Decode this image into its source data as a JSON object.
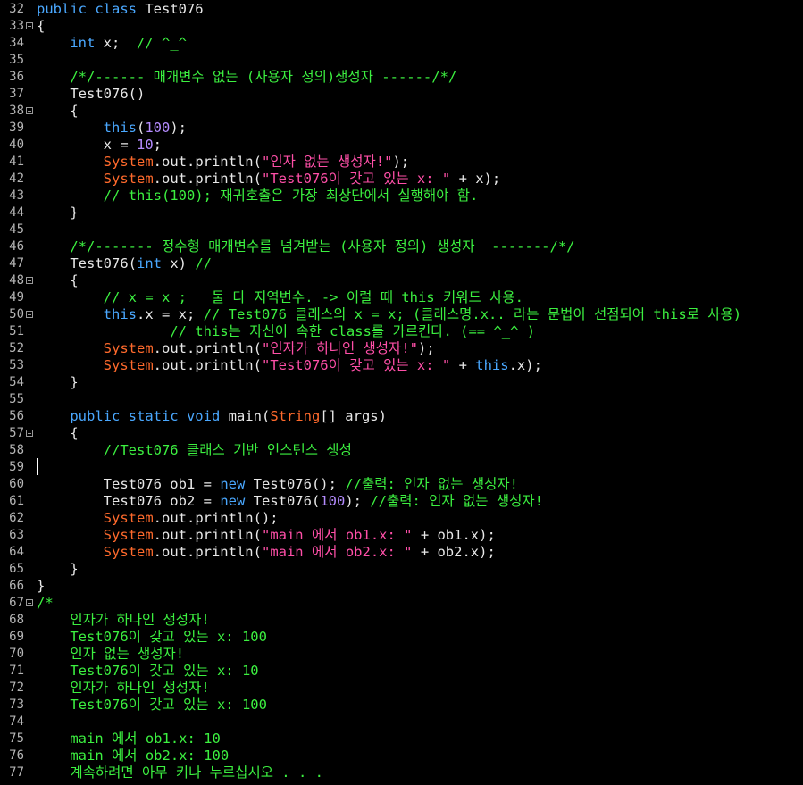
{
  "editor": {
    "colors": {
      "background": "#000000",
      "text": "#e8e8e8",
      "keyword": "#4aa8ff",
      "string": "#ff4fa8",
      "class": "#ff6a2c",
      "comment": "#3cf040",
      "number": "#b58cff",
      "line_number": "#b4b4b4"
    },
    "current_line": 59,
    "lines": [
      {
        "n": 32,
        "fold": false,
        "tokens": [
          {
            "t": "kw",
            "v": "public class"
          },
          {
            "t": "txt",
            "v": " Test076"
          }
        ]
      },
      {
        "n": 33,
        "fold": true,
        "tokens": [
          {
            "t": "txt",
            "v": "{"
          }
        ]
      },
      {
        "n": 34,
        "fold": false,
        "tokens": [
          {
            "t": "kw",
            "v": "    int"
          },
          {
            "t": "txt",
            "v": " x;  "
          },
          {
            "t": "cmt",
            "v": "// ^_^"
          }
        ]
      },
      {
        "n": 35,
        "fold": false,
        "tokens": []
      },
      {
        "n": 36,
        "fold": false,
        "tokens": [
          {
            "t": "cmt",
            "v": "    /*/------ 매개변수 없는 (사용자 정의)생성자 ------/*/"
          }
        ]
      },
      {
        "n": 37,
        "fold": false,
        "tokens": [
          {
            "t": "txt",
            "v": "    Test076()"
          }
        ]
      },
      {
        "n": 38,
        "fold": true,
        "tokens": [
          {
            "t": "txt",
            "v": "    {"
          }
        ]
      },
      {
        "n": 39,
        "fold": false,
        "tokens": [
          {
            "t": "kw",
            "v": "        this"
          },
          {
            "t": "txt",
            "v": "("
          },
          {
            "t": "num",
            "v": "100"
          },
          {
            "t": "txt",
            "v": ");"
          }
        ]
      },
      {
        "n": 40,
        "fold": false,
        "tokens": [
          {
            "t": "txt",
            "v": "        x = "
          },
          {
            "t": "num",
            "v": "10"
          },
          {
            "t": "txt",
            "v": ";"
          }
        ]
      },
      {
        "n": 41,
        "fold": false,
        "tokens": [
          {
            "t": "cls",
            "v": "        System"
          },
          {
            "t": "txt",
            "v": ".out.println("
          },
          {
            "t": "str",
            "v": "\"인자 없는 생성자!\""
          },
          {
            "t": "txt",
            "v": ");"
          }
        ]
      },
      {
        "n": 42,
        "fold": false,
        "tokens": [
          {
            "t": "cls",
            "v": "        System"
          },
          {
            "t": "txt",
            "v": ".out.println("
          },
          {
            "t": "str",
            "v": "\"Test076이 갖고 있는 x: \""
          },
          {
            "t": "txt",
            "v": " + x);"
          }
        ]
      },
      {
        "n": 43,
        "fold": false,
        "tokens": [
          {
            "t": "cmt",
            "v": "        // this(100); 재귀호출은 가장 최상단에서 실행해야 함."
          }
        ]
      },
      {
        "n": 44,
        "fold": false,
        "tokens": [
          {
            "t": "txt",
            "v": "    }"
          }
        ]
      },
      {
        "n": 45,
        "fold": false,
        "tokens": []
      },
      {
        "n": 46,
        "fold": false,
        "tokens": [
          {
            "t": "cmt",
            "v": "    /*/------- 정수형 매개변수를 넘겨받는 (사용자 정의) 생성자  -------/*/"
          }
        ]
      },
      {
        "n": 47,
        "fold": false,
        "tokens": [
          {
            "t": "txt",
            "v": "    Test076("
          },
          {
            "t": "kw",
            "v": "int"
          },
          {
            "t": "txt",
            "v": " x) "
          },
          {
            "t": "cmt",
            "v": "//"
          }
        ]
      },
      {
        "n": 48,
        "fold": true,
        "tokens": [
          {
            "t": "txt",
            "v": "    {"
          }
        ]
      },
      {
        "n": 49,
        "fold": false,
        "tokens": [
          {
            "t": "cmt",
            "v": "        // x = x ;   둘 다 지역변수. -> 이럴 때 this 키워드 사용."
          }
        ]
      },
      {
        "n": 50,
        "fold": true,
        "tokens": [
          {
            "t": "kw",
            "v": "        this"
          },
          {
            "t": "txt",
            "v": ".x = x; "
          },
          {
            "t": "cmt",
            "v": "// Test076 클래스의 x = x; (클래스명.x.. 라는 문법이 선점되어 this로 사용)"
          }
        ]
      },
      {
        "n": 51,
        "fold": false,
        "tokens": [
          {
            "t": "cmt",
            "v": "                // this는 자신이 속한 class를 가르킨다. (== ^_^ )"
          }
        ]
      },
      {
        "n": 52,
        "fold": false,
        "tokens": [
          {
            "t": "cls",
            "v": "        System"
          },
          {
            "t": "txt",
            "v": ".out.println("
          },
          {
            "t": "str",
            "v": "\"인자가 하나인 생성자!\""
          },
          {
            "t": "txt",
            "v": ");"
          }
        ]
      },
      {
        "n": 53,
        "fold": false,
        "tokens": [
          {
            "t": "cls",
            "v": "        System"
          },
          {
            "t": "txt",
            "v": ".out.println("
          },
          {
            "t": "str",
            "v": "\"Test076이 갖고 있는 x: \""
          },
          {
            "t": "txt",
            "v": " + "
          },
          {
            "t": "kw",
            "v": "this"
          },
          {
            "t": "txt",
            "v": ".x);"
          }
        ]
      },
      {
        "n": 54,
        "fold": false,
        "tokens": [
          {
            "t": "txt",
            "v": "    }"
          }
        ]
      },
      {
        "n": 55,
        "fold": false,
        "tokens": []
      },
      {
        "n": 56,
        "fold": false,
        "tokens": [
          {
            "t": "kw",
            "v": "    public static void"
          },
          {
            "t": "txt",
            "v": " main("
          },
          {
            "t": "cls",
            "v": "String"
          },
          {
            "t": "txt",
            "v": "[] args)"
          }
        ]
      },
      {
        "n": 57,
        "fold": true,
        "tokens": [
          {
            "t": "txt",
            "v": "    {"
          }
        ]
      },
      {
        "n": 58,
        "fold": false,
        "tokens": [
          {
            "t": "cmt",
            "v": "        //Test076 클래스 기반 인스턴스 생성"
          }
        ]
      },
      {
        "n": 59,
        "fold": false,
        "tokens": []
      },
      {
        "n": 60,
        "fold": false,
        "tokens": [
          {
            "t": "txt",
            "v": "        Test076 ob1 = "
          },
          {
            "t": "kw",
            "v": "new"
          },
          {
            "t": "txt",
            "v": " Test076(); "
          },
          {
            "t": "cmt",
            "v": "//출력: 인자 없는 생성자!"
          }
        ]
      },
      {
        "n": 61,
        "fold": false,
        "tokens": [
          {
            "t": "txt",
            "v": "        Test076 ob2 = "
          },
          {
            "t": "kw",
            "v": "new"
          },
          {
            "t": "txt",
            "v": " Test076("
          },
          {
            "t": "num",
            "v": "100"
          },
          {
            "t": "txt",
            "v": "); "
          },
          {
            "t": "cmt",
            "v": "//출력: 인자 없는 생성자!"
          }
        ]
      },
      {
        "n": 62,
        "fold": false,
        "tokens": [
          {
            "t": "cls",
            "v": "        System"
          },
          {
            "t": "txt",
            "v": ".out.println();"
          }
        ]
      },
      {
        "n": 63,
        "fold": false,
        "tokens": [
          {
            "t": "cls",
            "v": "        System"
          },
          {
            "t": "txt",
            "v": ".out.println("
          },
          {
            "t": "str",
            "v": "\"main 에서 ob1.x: \""
          },
          {
            "t": "txt",
            "v": " + ob1.x);"
          }
        ]
      },
      {
        "n": 64,
        "fold": false,
        "tokens": [
          {
            "t": "cls",
            "v": "        System"
          },
          {
            "t": "txt",
            "v": ".out.println("
          },
          {
            "t": "str",
            "v": "\"main 에서 ob2.x: \""
          },
          {
            "t": "txt",
            "v": " + ob2.x);"
          }
        ]
      },
      {
        "n": 65,
        "fold": false,
        "tokens": [
          {
            "t": "txt",
            "v": "    }"
          }
        ]
      },
      {
        "n": 66,
        "fold": false,
        "tokens": [
          {
            "t": "txt",
            "v": "}"
          }
        ]
      },
      {
        "n": 67,
        "fold": true,
        "tokens": [
          {
            "t": "cmt",
            "v": "/*"
          }
        ]
      },
      {
        "n": 68,
        "fold": false,
        "tokens": [
          {
            "t": "cmt",
            "v": "    인자가 하나인 생성자!"
          }
        ]
      },
      {
        "n": 69,
        "fold": false,
        "tokens": [
          {
            "t": "cmt",
            "v": "    Test076이 갖고 있는 x: 100"
          }
        ]
      },
      {
        "n": 70,
        "fold": false,
        "tokens": [
          {
            "t": "cmt",
            "v": "    인자 없는 생성자!"
          }
        ]
      },
      {
        "n": 71,
        "fold": false,
        "tokens": [
          {
            "t": "cmt",
            "v": "    Test076이 갖고 있는 x: 10"
          }
        ]
      },
      {
        "n": 72,
        "fold": false,
        "tokens": [
          {
            "t": "cmt",
            "v": "    인자가 하나인 생성자!"
          }
        ]
      },
      {
        "n": 73,
        "fold": false,
        "tokens": [
          {
            "t": "cmt",
            "v": "    Test076이 갖고 있는 x: 100"
          }
        ]
      },
      {
        "n": 74,
        "fold": false,
        "tokens": []
      },
      {
        "n": 75,
        "fold": false,
        "tokens": [
          {
            "t": "cmt",
            "v": "    main 에서 ob1.x: 10"
          }
        ]
      },
      {
        "n": 76,
        "fold": false,
        "tokens": [
          {
            "t": "cmt",
            "v": "    main 에서 ob2.x: 100"
          }
        ]
      },
      {
        "n": 77,
        "fold": false,
        "tokens": [
          {
            "t": "cmt",
            "v": "    계속하려면 아무 키나 누르십시오 . . ."
          }
        ]
      }
    ]
  }
}
